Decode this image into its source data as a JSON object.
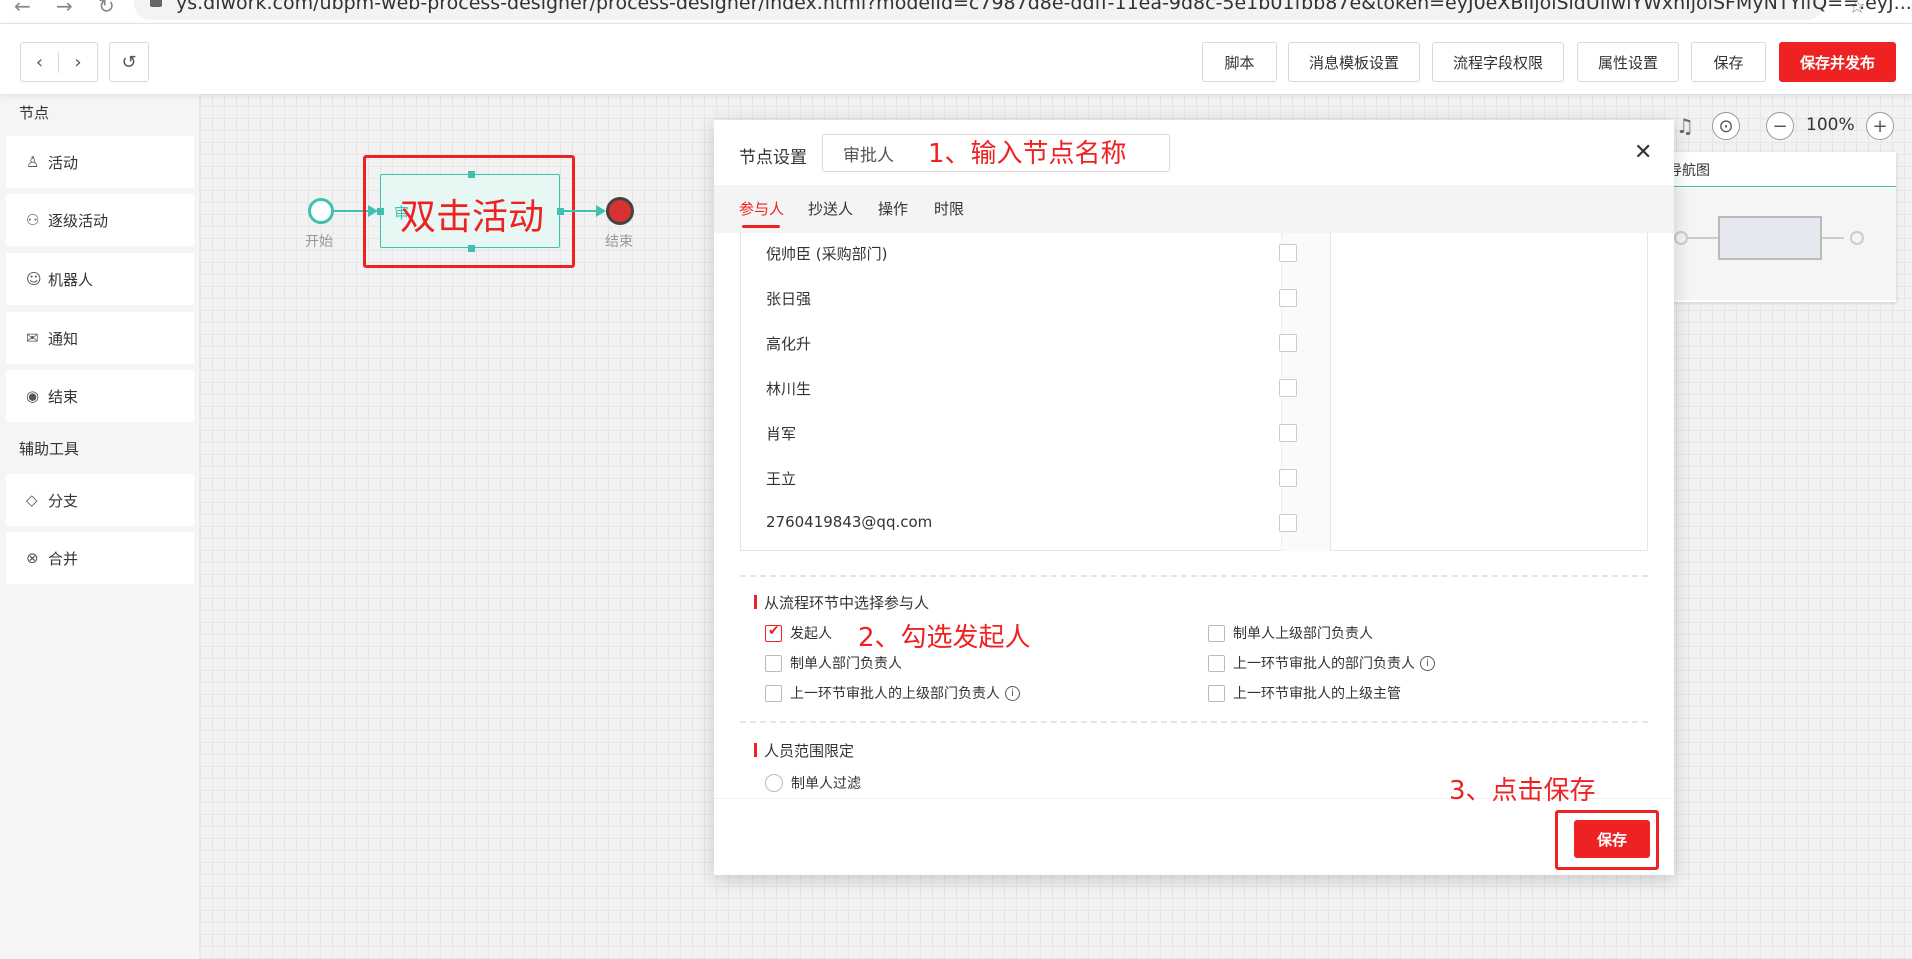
{
  "browser": {
    "url": "ys.diwork.com/ubpm-web-process-designer/process-designer/index.html?modelId=c7987d8e-ddff-11ea-9d8c-5e1b01fbb87e&token=eyJ0eXBlIjoiSldUIiwiYWxnIjoiSFMyNTYifQ==.eyJ..."
  },
  "toolbar": {
    "script_label": "脚本",
    "msg_template_label": "消息模板设置",
    "field_permission_label": "流程字段权限",
    "property_label": "属性设置",
    "save_label": "保存",
    "save_publish_label": "保存并发布"
  },
  "sidebar": {
    "nodes_heading": "节点",
    "items": [
      {
        "label": "活动",
        "icon": "user-icon"
      },
      {
        "label": "逐级活动",
        "icon": "org-icon"
      },
      {
        "label": "机器人",
        "icon": "robot-icon"
      },
      {
        "label": "通知",
        "icon": "mail-icon"
      },
      {
        "label": "结束",
        "icon": "end-icon"
      }
    ],
    "tools_heading": "辅助工具",
    "tools": [
      {
        "label": "分支",
        "icon": "branch-icon"
      },
      {
        "label": "合并",
        "icon": "merge-icon"
      }
    ]
  },
  "canvas": {
    "start_label": "开始",
    "end_label": "结束",
    "activity_annotation": "双击活动",
    "activity_partial_label": "审",
    "zoom": "100%",
    "minimap_title": "导航图"
  },
  "dialog": {
    "title": "节点设置",
    "name_value": "审批人",
    "name_annotation": "1、输入节点名称",
    "tabs": [
      "参与人",
      "抄送人",
      "操作",
      "时限"
    ],
    "members": [
      "倪帅臣 (采购部门)",
      "张日强",
      "高化升",
      "林川生",
      "肖军",
      "王立",
      "2760419843@qq.com"
    ],
    "section1_title": "从流程环节中选择参与人",
    "options_left": [
      "发起人",
      "制单人部门负责人",
      "上一环节审批人的上级部门负责人"
    ],
    "options_right": [
      "制单人上级部门负责人",
      "上一环节审批人的部门负责人",
      "上一环节审批人的上级主管"
    ],
    "check_annotation": "2、勾选发起人",
    "section2_title": "人员范围限定",
    "radio_label": "制单人过滤",
    "save_annotation": "3、点击保存",
    "save_label": "保存"
  },
  "colors": {
    "accent": "#ee2223",
    "teal": "#3fc1b0"
  }
}
